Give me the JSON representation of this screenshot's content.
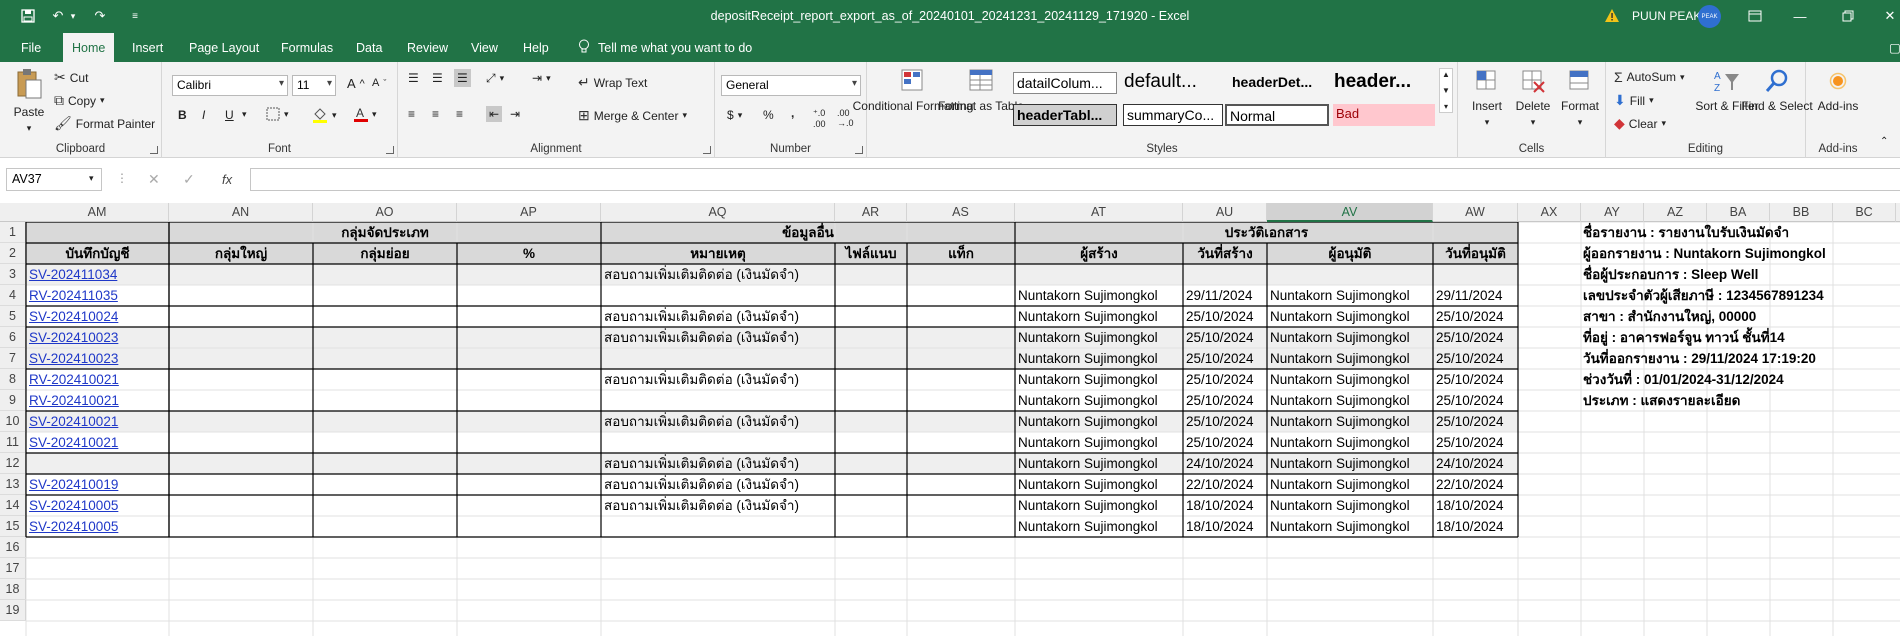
{
  "titlebar": {
    "title": "depositReceipt_report_export_as_of_20240101_20241231_20241129_171920  -  Excel",
    "user": "PUUN PEAK",
    "avatar_initials": "PEAK"
  },
  "tabs": [
    "File",
    "Home",
    "Insert",
    "Page Layout",
    "Formulas",
    "Data",
    "Review",
    "View",
    "Help"
  ],
  "active_tab": "Home",
  "tellme": "Tell me what you want to do",
  "ribbon": {
    "clipboard": {
      "paste": "Paste",
      "cut": "Cut",
      "copy": "Copy",
      "format_painter": "Format Painter",
      "label": "Clipboard"
    },
    "font": {
      "name": "Calibri",
      "size": "11",
      "label": "Font",
      "bold": "B",
      "italic": "I",
      "underline": "U"
    },
    "alignment": {
      "wrap": "Wrap Text",
      "merge": "Merge & Center",
      "label": "Alignment"
    },
    "number": {
      "format": "General",
      "label": "Number",
      "currency": "$",
      "percent": "%",
      "comma": ","
    },
    "styles": {
      "cond": "Conditional Formatting",
      "table": "Format as Table",
      "label": "Styles",
      "items": [
        "datailColum...",
        "default...",
        "headerDet...",
        "header...",
        "headerTabl...",
        "summaryCo...",
        "Normal",
        "Bad"
      ]
    },
    "cells": {
      "insert": "Insert",
      "delete": "Delete",
      "format": "Format",
      "label": "Cells"
    },
    "editing": {
      "autosum": "AutoSum",
      "fill": "Fill",
      "clear": "Clear",
      "sort": "Sort & Filter",
      "find": "Find & Select",
      "label": "Editing"
    },
    "addins": {
      "addins": "Add-ins",
      "label": "Add-ins"
    }
  },
  "formula_bar": {
    "name_box": "AV37",
    "fx": "fx",
    "value": ""
  },
  "columns": [
    "AM",
    "AN",
    "AO",
    "AP",
    "AQ",
    "AR",
    "AS",
    "AT",
    "AU",
    "AV",
    "AW",
    "AX",
    "AY",
    "AZ",
    "BA",
    "BB",
    "BC"
  ],
  "selected_column": "AV",
  "rows": [
    "1",
    "2",
    "3",
    "4",
    "5",
    "6",
    "7",
    "8",
    "9",
    "10",
    "11",
    "12",
    "13",
    "14",
    "15",
    "16",
    "17",
    "18",
    "19"
  ],
  "sheet": {
    "group_headers": {
      "category": "กลุ่มจัดประเภท",
      "other_info": "ข้อมูลอื่น",
      "history": "ประวัติเอกสาร"
    },
    "headers": [
      "บันทึกบัญชี",
      "กลุ่มใหญ่",
      "กลุ่มย่อย",
      "%",
      "หมายเหตุ",
      "ไฟล์แนบ",
      "แท็ก",
      "ผู้สร้าง",
      "วันที่สร้าง",
      "ผู้อนุมัติ",
      "วันที่อนุมัติ"
    ],
    "data": [
      {
        "doc": "SV-202411034",
        "note": "สอบถามเพิ่มเติมติดต่อ (เงินมัดจำ)",
        "creator": "",
        "created": "",
        "approver": "",
        "approved": ""
      },
      {
        "doc": "RV-202411035",
        "note": "",
        "creator": "Nuntakorn Sujimongkol",
        "created": "29/11/2024",
        "approver": "Nuntakorn Sujimongkol",
        "approved": "29/11/2024"
      },
      {
        "doc": "SV-202410024",
        "note": "สอบถามเพิ่มเติมติดต่อ (เงินมัดจำ)",
        "creator": "Nuntakorn Sujimongkol",
        "created": "25/10/2024",
        "approver": "Nuntakorn Sujimongkol",
        "approved": "25/10/2024"
      },
      {
        "doc": "SV-202410023",
        "note": "สอบถามเพิ่มเติมติดต่อ (เงินมัดจำ)",
        "creator": "Nuntakorn Sujimongkol",
        "created": "25/10/2024",
        "approver": "Nuntakorn Sujimongkol",
        "approved": "25/10/2024"
      },
      {
        "doc": "SV-202410023",
        "note": "",
        "creator": "Nuntakorn Sujimongkol",
        "created": "25/10/2024",
        "approver": "Nuntakorn Sujimongkol",
        "approved": "25/10/2024"
      },
      {
        "doc": "RV-202410021",
        "note": "สอบถามเพิ่มเติมติดต่อ (เงินมัดจำ)",
        "creator": "Nuntakorn Sujimongkol",
        "created": "25/10/2024",
        "approver": "Nuntakorn Sujimongkol",
        "approved": "25/10/2024"
      },
      {
        "doc": "RV-202410021",
        "note": "",
        "creator": "Nuntakorn Sujimongkol",
        "created": "25/10/2024",
        "approver": "Nuntakorn Sujimongkol",
        "approved": "25/10/2024"
      },
      {
        "doc": "SV-202410021",
        "note": "สอบถามเพิ่มเติมติดต่อ (เงินมัดจำ)",
        "creator": "Nuntakorn Sujimongkol",
        "created": "25/10/2024",
        "approver": "Nuntakorn Sujimongkol",
        "approved": "25/10/2024"
      },
      {
        "doc": "SV-202410021",
        "note": "",
        "creator": "Nuntakorn Sujimongkol",
        "created": "25/10/2024",
        "approver": "Nuntakorn Sujimongkol",
        "approved": "25/10/2024"
      },
      {
        "doc": "",
        "note": "สอบถามเพิ่มเติมติดต่อ (เงินมัดจำ)",
        "creator": "Nuntakorn Sujimongkol",
        "created": "24/10/2024",
        "approver": "Nuntakorn Sujimongkol",
        "approved": "24/10/2024"
      },
      {
        "doc": "SV-202410019",
        "note": "สอบถามเพิ่มเติมติดต่อ (เงินมัดจำ)",
        "creator": "Nuntakorn Sujimongkol",
        "created": "22/10/2024",
        "approver": "Nuntakorn Sujimongkol",
        "approved": "22/10/2024"
      },
      {
        "doc": "SV-202410005",
        "note": "สอบถามเพิ่มเติมติดต่อ (เงินมัดจำ)",
        "creator": "Nuntakorn Sujimongkol",
        "created": "18/10/2024",
        "approver": "Nuntakorn Sujimongkol",
        "approved": "18/10/2024"
      },
      {
        "doc": "SV-202410005",
        "note": "",
        "creator": "Nuntakorn Sujimongkol",
        "created": "18/10/2024",
        "approver": "Nuntakorn Sujimongkol",
        "approved": "18/10/2024"
      }
    ],
    "info": [
      "ชื่อรายงาน : รายงานใบรับเงินมัดจำ",
      "ผู้ออกรายงาน : Nuntakorn Sujimongkol",
      "ชื่อผู้ประกอบการ :  Sleep Well",
      "เลขประจำตัวผู้เสียภาษี : 1234567891234",
      "สาขา : สำนักงานใหญ่, 00000",
      "ที่อยู่ : อาคารฟอร์จูน ทาวน์ ชั้นที่14",
      "วันที่ออกรายงาน : 29/11/2024 17:19:20",
      "ช่วงวันที่ : 01/01/2024-31/12/2024",
      "ประเภท : แสดงรายละเอียด"
    ]
  },
  "colors": {
    "excel_green": "#217346",
    "link": "#1f38c8",
    "header_fill": "#d9d9d9",
    "band_fill": "#efefef",
    "bad_fill": "#ffc7ce"
  }
}
